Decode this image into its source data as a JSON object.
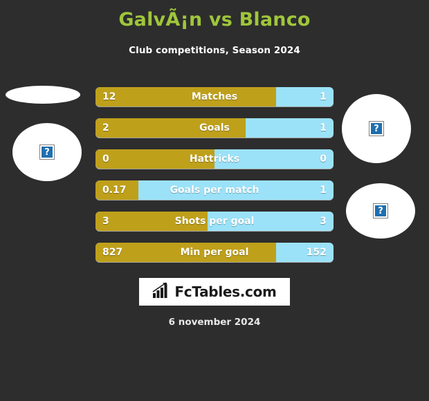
{
  "header": {
    "title": "GalvÃ¡n vs Blanco",
    "subtitle": "Club competitions, Season 2024"
  },
  "colors": {
    "background": "#2d2d2d",
    "title": "#9fc63b",
    "player_left_bar": "#bfa01b",
    "player_right_bar": "#9be2f8",
    "text": "#ffffff"
  },
  "stats": [
    {
      "label": "Matches",
      "left": "12",
      "right": "1",
      "left_pct": 76
    },
    {
      "label": "Goals",
      "left": "2",
      "right": "1",
      "left_pct": 63
    },
    {
      "label": "Hattricks",
      "left": "0",
      "right": "0",
      "left_pct": 50
    },
    {
      "label": "Goals per match",
      "left": "0.17",
      "right": "1",
      "left_pct": 18
    },
    {
      "label": "Shots per goal",
      "left": "3",
      "right": "3",
      "left_pct": 47
    },
    {
      "label": "Min per goal",
      "left": "827",
      "right": "152",
      "left_pct": 76
    }
  ],
  "placeholders": [
    {
      "name": "left-team-logo-placeholder",
      "missing_glyph": "?"
    },
    {
      "name": "left-player-photo-placeholder",
      "missing_glyph": "?"
    },
    {
      "name": "right-player-photo-placeholder",
      "missing_glyph": "?"
    },
    {
      "name": "right-team-logo-placeholder",
      "missing_glyph": "?"
    }
  ],
  "footer": {
    "logo_text": "FcTables.com",
    "logo_icon": "bar-chart-growth-icon",
    "date": "6 november 2024"
  }
}
